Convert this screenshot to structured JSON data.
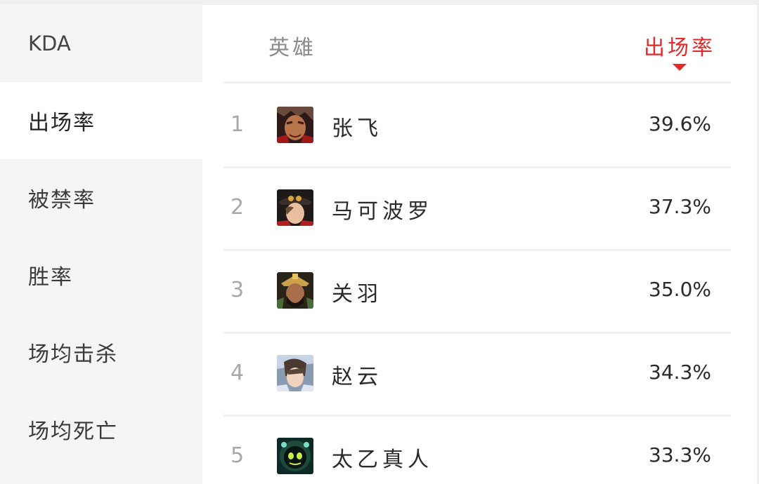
{
  "sidebar": {
    "items": [
      {
        "label": "KDA",
        "active": false
      },
      {
        "label": "出场率",
        "active": true
      },
      {
        "label": "被禁率",
        "active": false
      },
      {
        "label": "胜率",
        "active": false
      },
      {
        "label": "场均击杀",
        "active": false
      },
      {
        "label": "场均死亡",
        "active": false
      }
    ]
  },
  "table": {
    "header": {
      "hero_label": "英雄",
      "sort_label": "出场率",
      "sort_icon": "caret-down-icon",
      "accent_color": "#e32a2a"
    },
    "rows": [
      {
        "rank": "1",
        "name": "张飞",
        "rate": "39.6%",
        "avatar": "zhangfei-avatar"
      },
      {
        "rank": "2",
        "name": "马可波罗",
        "rate": "37.3%",
        "avatar": "marco-polo-avatar"
      },
      {
        "rank": "3",
        "name": "关羽",
        "rate": "35.0%",
        "avatar": "guanyu-avatar"
      },
      {
        "rank": "4",
        "name": "赵云",
        "rate": "34.3%",
        "avatar": "zhaoyun-avatar"
      },
      {
        "rank": "5",
        "name": "太乙真人",
        "rate": "33.3%",
        "avatar": "taiyi-avatar"
      }
    ]
  }
}
